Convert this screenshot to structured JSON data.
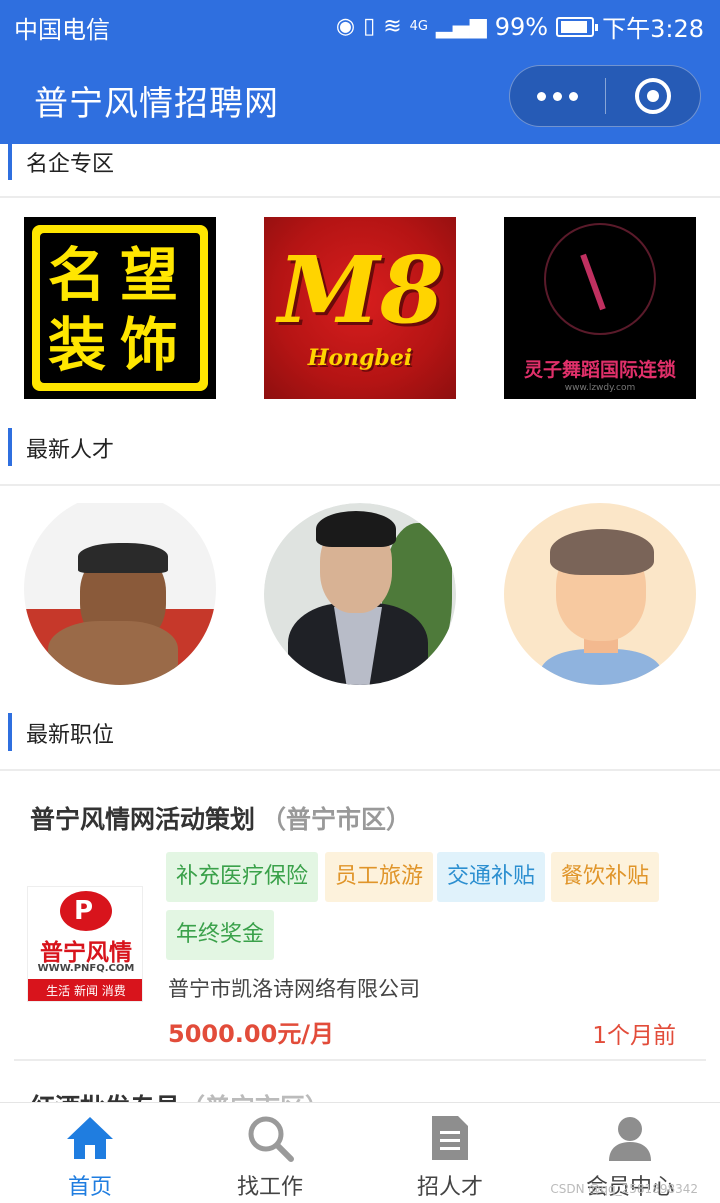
{
  "status_bar": {
    "carrier": "中国电信",
    "battery": "99%",
    "time": "下午3:28",
    "network": "4G"
  },
  "title_bar": {
    "title": "普宁风情招聘网"
  },
  "sections": {
    "famous_companies": "名企专区",
    "latest_talent": "最新人才",
    "latest_jobs": "最新职位"
  },
  "company_logos": [
    {
      "name": "名望装饰",
      "chars": [
        "名",
        "望",
        "装",
        "饰"
      ]
    },
    {
      "name": "M8 Hongbei",
      "main": "M8",
      "sub": "Hongbei"
    },
    {
      "name": "灵子舞蹈国际连锁",
      "brand": "灵子舞蹈国际连锁",
      "url": "www.lzwdy.com"
    }
  ],
  "jobs": [
    {
      "title": "普宁风情网活动策划",
      "location": "（普宁市区）",
      "logo": {
        "name": "普宁风情",
        "web": "WWW.PNFQ.COM",
        "slogan": "生活 新闻 消费"
      },
      "tags": [
        {
          "label": "补充医疗保险",
          "color": "#3aa14a",
          "bg": "#e3f6e3"
        },
        {
          "label": "员工旅游",
          "color": "#e0952a",
          "bg": "#fdf2dc"
        },
        {
          "label": "交通补贴",
          "color": "#2c8fd0",
          "bg": "#e0f2fb"
        },
        {
          "label": "餐饮补贴",
          "color": "#e0952a",
          "bg": "#fdf2dc"
        },
        {
          "label": "年终奖金",
          "color": "#3aa14a",
          "bg": "#e3f6e3"
        }
      ],
      "company": "普宁市凯洛诗网络有限公司",
      "salary": "5000.00元/月",
      "posted": "1个月前"
    },
    {
      "title": "红酒批发专员",
      "location": "（普宁市区）"
    }
  ],
  "tab_bar": [
    {
      "label": "首页",
      "icon": "home-icon",
      "active": true
    },
    {
      "label": "找工作",
      "icon": "search-icon",
      "active": false
    },
    {
      "label": "招人才",
      "icon": "document-icon",
      "active": false
    },
    {
      "label": "会员中心",
      "icon": "user-icon",
      "active": false
    }
  ],
  "watermark": "CSDN @qq_2581898342",
  "colors": {
    "primary": "#2f6fdf",
    "tab_active": "#1f7de0",
    "salary": "#e24c3a"
  }
}
